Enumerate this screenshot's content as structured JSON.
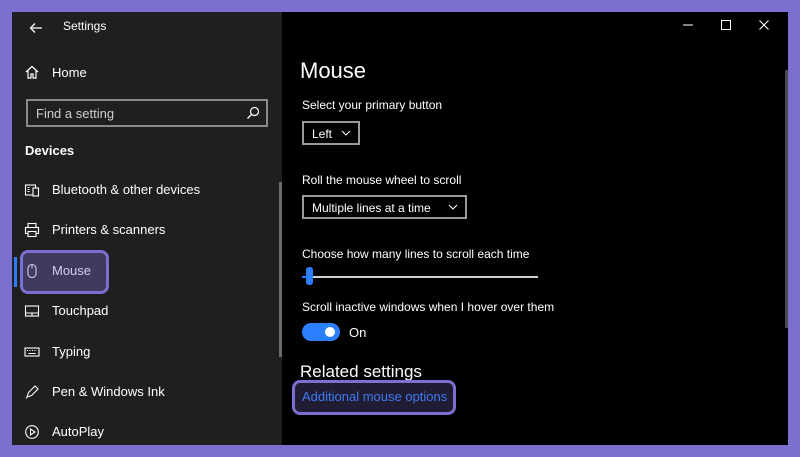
{
  "window": {
    "title": "Settings"
  },
  "sidebar": {
    "home_label": "Home",
    "search": {
      "placeholder": "Find a setting"
    },
    "section_title": "Devices",
    "items": [
      {
        "label": "Bluetooth & other devices",
        "icon": "bluetooth-devices-icon",
        "active": false
      },
      {
        "label": "Printers & scanners",
        "icon": "printer-icon",
        "active": false
      },
      {
        "label": "Mouse",
        "icon": "mouse-icon",
        "active": true
      },
      {
        "label": "Touchpad",
        "icon": "touchpad-icon",
        "active": false
      },
      {
        "label": "Typing",
        "icon": "keyboard-icon",
        "active": false
      },
      {
        "label": "Pen & Windows Ink",
        "icon": "pen-icon",
        "active": false
      },
      {
        "label": "AutoPlay",
        "icon": "autoplay-icon",
        "active": false
      }
    ]
  },
  "main": {
    "title": "Mouse",
    "primary_button": {
      "label": "Select your primary button",
      "value": "Left"
    },
    "scroll_setting": {
      "label": "Roll the mouse wheel to scroll",
      "value": "Multiple lines at a time"
    },
    "lines_setting": {
      "label": "Choose how many lines to scroll each time",
      "slider_fraction": 0.03
    },
    "inactive_scroll": {
      "label": "Scroll inactive windows when I hover over them",
      "state": "On"
    },
    "related": {
      "title": "Related settings",
      "link": "Additional mouse options"
    }
  },
  "colors": {
    "accent": "#2b7fff",
    "sidebar_bg": "#1f1f1f",
    "main_bg": "#000000",
    "frame": "#7b6fcf"
  }
}
